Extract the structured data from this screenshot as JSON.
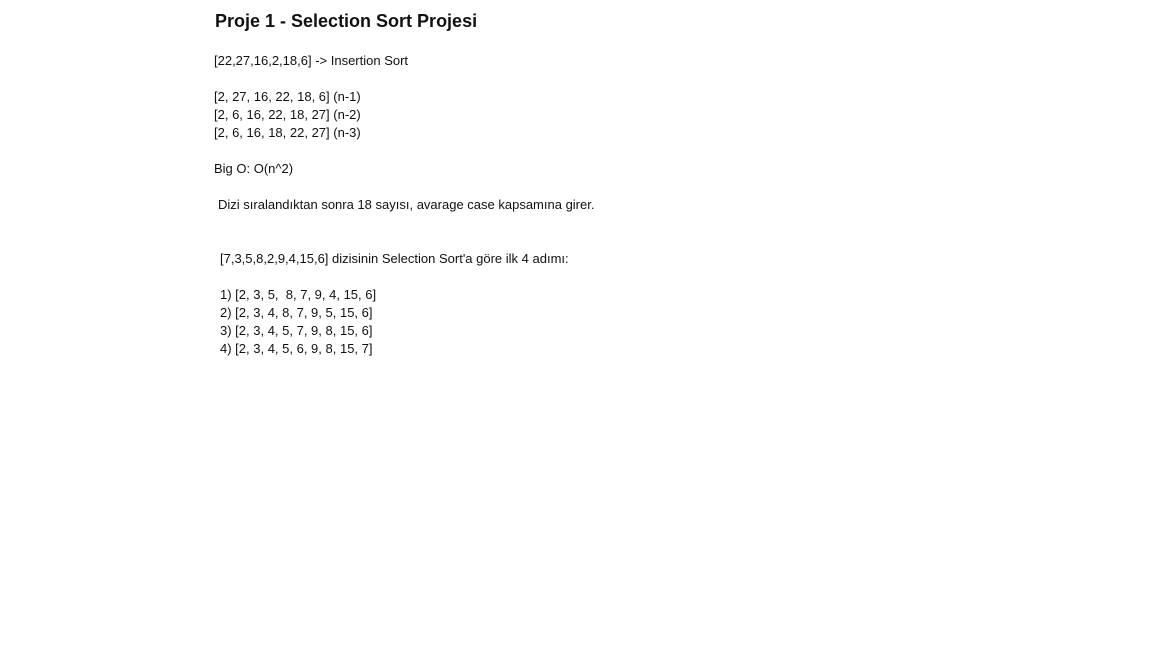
{
  "document": {
    "title": "Proje 1 - Selection Sort Projesi",
    "insertion": {
      "header": "[22,27,16,2,18,6] -> Insertion Sort",
      "steps": [
        "[2, 27, 16, 22, 18, 6] (n-1)",
        "[2, 6, 16, 22, 18, 27] (n-2)",
        "[2, 6, 16, 18, 22, 27] (n-3)"
      ],
      "big_o": "Big O: O(n^2)",
      "note": "Dizi sıralandıktan sonra 18 sayısı, avarage case kapsamına girer."
    },
    "selection": {
      "header": "[7,3,5,8,2,9,4,15,6] dizisinin Selection Sort'a göre ilk 4 adımı:",
      "steps": [
        "1) [2, 3, 5,  8, 7, 9, 4, 15, 6]",
        "2) [2, 3, 4, 8, 7, 9, 5, 15, 6]",
        "3) [2, 3, 4, 5, 7, 9, 8, 15, 6]",
        "4) [2, 3, 4, 5, 6, 9, 8, 15, 7]"
      ]
    }
  }
}
